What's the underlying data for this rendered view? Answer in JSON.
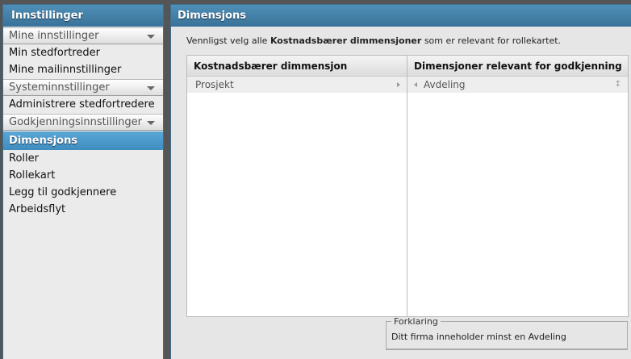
{
  "sidebar": {
    "title": "Innstillinger",
    "groups": [
      {
        "label": "Mine innstillinger",
        "items": [
          "Min stedfortreder",
          "Mine mailinnstillinger"
        ]
      },
      {
        "label": "Systeminnstillinger",
        "items": [
          "Administrere stedfortredere"
        ]
      },
      {
        "label": "Godkjenningsinnstillinger",
        "active": "Dimensjons",
        "items": [
          "Roller",
          "Rollekart",
          "Legg til godkjennere",
          "Arbeidsflyt"
        ]
      }
    ]
  },
  "main": {
    "title": "Dimensjons",
    "intro_pre": "Vennligst velg alle ",
    "intro_bold": "Kostnadsbærer dimmensjoner",
    "intro_post": " som er relevant for rollekartet.",
    "left": {
      "header": "Kostnadsbærer dimmensjon",
      "items": [
        "Prosjekt"
      ]
    },
    "right": {
      "header": "Dimensjoner relevant for godkjenning",
      "items": [
        "Avdeling"
      ]
    },
    "legend": {
      "title": "Forklaring",
      "text": "Ditt firma inneholder minst en Avdeling"
    }
  }
}
